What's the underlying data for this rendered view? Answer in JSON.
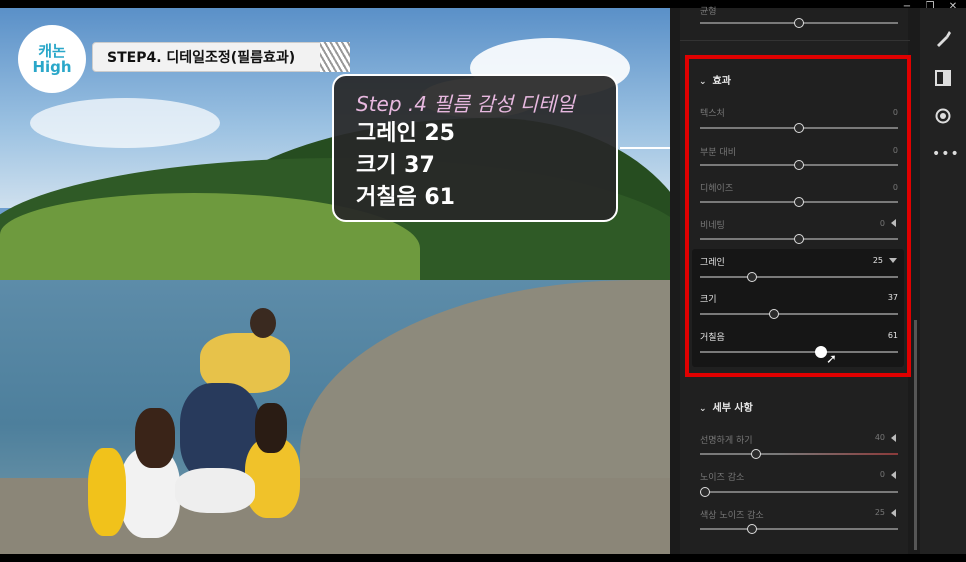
{
  "overlay": {
    "badge_text": "캐논\nHigh",
    "step_banner": "STEP4. 디테일조정(필름효과)",
    "callout": {
      "line0": "Step .4 필름 감성 디테일",
      "line1": "그레인 25",
      "line2": "크기 37",
      "line3": "거칠음 61"
    }
  },
  "window_controls": [
    "−",
    "❐",
    "✕"
  ],
  "top_row": {
    "label": "균형"
  },
  "effects": {
    "title": "효과",
    "rows": [
      {
        "label": "텍스처",
        "value": "0"
      },
      {
        "label": "부분 대비",
        "value": "0"
      },
      {
        "label": "디헤이즈",
        "value": "0"
      },
      {
        "label": "비네팅",
        "value": "0"
      }
    ],
    "grain": {
      "label": "그레인",
      "value": "25"
    },
    "size": {
      "label": "크기",
      "value": "37"
    },
    "roughness": {
      "label": "거칠음",
      "value": "61"
    }
  },
  "detail": {
    "title": "세부 사항",
    "rows": [
      {
        "label": "선명하게 하기",
        "value": "40"
      },
      {
        "label": "노이즈 감소",
        "value": "0"
      },
      {
        "label": "색상 노이즈 감소",
        "value": "25"
      }
    ]
  },
  "sidebar_icons": [
    "brush-icon",
    "square-icon",
    "circle-icon",
    "more-icon"
  ],
  "colors": {
    "highlight": "#e00000",
    "callout_title": "#e7b8df"
  }
}
